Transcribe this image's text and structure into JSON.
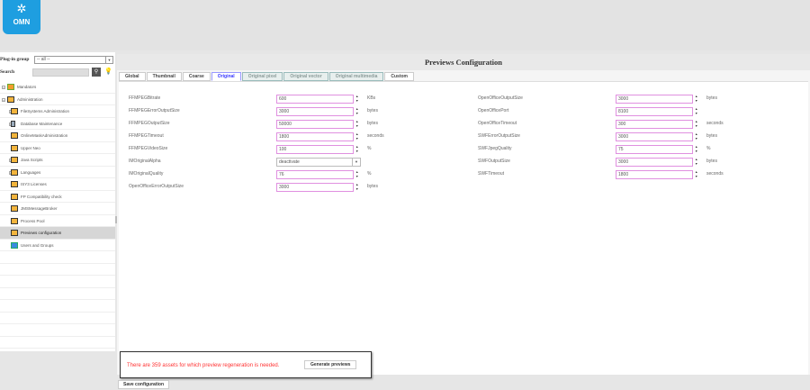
{
  "app": {
    "logo_text": "OMN"
  },
  "sidebar": {
    "plugin_group_label": "Plug-in group",
    "plugin_group_value": "-- all --",
    "search_label": "Search",
    "search_value": "",
    "items": [
      {
        "label": "Mandators",
        "level": 0,
        "expand": true,
        "icon": "mandators-icon"
      },
      {
        "label": "Administration",
        "level": 0,
        "expand": true,
        "icon": "plugin-icon"
      },
      {
        "label": "FileSystems Administration",
        "level": 1,
        "expand": true,
        "icon": "plugin-icon"
      },
      {
        "label": "Database Maintenance",
        "level": 1,
        "expand": true,
        "icon": "database-icon"
      },
      {
        "label": "OnlineMaskAdministration",
        "level": 1,
        "expand": false,
        "icon": "plugin-icon"
      },
      {
        "label": "Upper Neo",
        "level": 1,
        "expand": false,
        "icon": "plugin-icon"
      },
      {
        "label": "Java Scripts",
        "level": 1,
        "expand": true,
        "icon": "plugin-icon"
      },
      {
        "label": "Languages",
        "level": 1,
        "expand": true,
        "icon": "plugin-icon"
      },
      {
        "label": "ISY3 Licenses",
        "level": 1,
        "expand": false,
        "icon": "plugin-icon"
      },
      {
        "label": "FP Compatibility check",
        "level": 1,
        "expand": false,
        "icon": "plugin-icon"
      },
      {
        "label": "JMSMessageBroker",
        "level": 1,
        "expand": false,
        "icon": "plugin-icon"
      },
      {
        "label": "Process Pool",
        "level": 1,
        "expand": false,
        "icon": "plugin-icon"
      },
      {
        "label": "Previews configuration",
        "level": 1,
        "expand": false,
        "icon": "plugin-icon",
        "selected": true
      },
      {
        "label": "Users and Groups",
        "level": 1,
        "expand": false,
        "icon": "users-icon"
      }
    ]
  },
  "main": {
    "title": "Previews Configuration",
    "tabs": [
      {
        "label": "Global"
      },
      {
        "label": "Thumbnail"
      },
      {
        "label": "Coarse"
      },
      {
        "label": "Original",
        "active": true
      },
      {
        "label": "Original pixel",
        "disabled": true
      },
      {
        "label": "Original vector",
        "disabled": true
      },
      {
        "label": "Original multimedia",
        "disabled": true
      },
      {
        "label": "Custom"
      }
    ],
    "left_fields": [
      {
        "label": "FFMPEGBitrate",
        "value": "600",
        "unit": "KBs"
      },
      {
        "label": "FFMPEGErrorOutputSize",
        "value": "3000",
        "unit": "bytes"
      },
      {
        "label": "FFMPEGOutputSize",
        "value": "50000",
        "unit": "bytes"
      },
      {
        "label": "FFMPEGTimeout",
        "value": "1800",
        "unit": "seconds"
      },
      {
        "label": "FFMPEGVideoSize",
        "value": "100",
        "unit": "%"
      },
      {
        "label": "IMOriginalAlpha",
        "value": "deactivate",
        "type": "select"
      },
      {
        "label": "IMOriginalQuality",
        "value": "76",
        "unit": "%"
      },
      {
        "label": "OpenOfficeErrorOutputSize",
        "value": "3000",
        "unit": "bytes"
      }
    ],
    "right_fields": [
      {
        "label": "OpenOfficeOutputSize",
        "value": "3000",
        "unit": "bytes"
      },
      {
        "label": "OpenOfficePort",
        "value": "8100",
        "unit": ""
      },
      {
        "label": "OpenOfficeTimeout",
        "value": "300",
        "unit": "seconds"
      },
      {
        "label": "SWFErrorOutputSize",
        "value": "3000",
        "unit": "bytes"
      },
      {
        "label": "SWFJpegQuality",
        "value": "75",
        "unit": "%"
      },
      {
        "label": "SWFOutputSize",
        "value": "3000",
        "unit": "bytes"
      },
      {
        "label": "SWFTimeout",
        "value": "1800",
        "unit": "seconds"
      }
    ]
  },
  "notice": {
    "message": "There are 359 assets for which preview regeneration is needed.",
    "button": "Generate previews"
  },
  "footer": {
    "save_label": "Save configuration"
  }
}
